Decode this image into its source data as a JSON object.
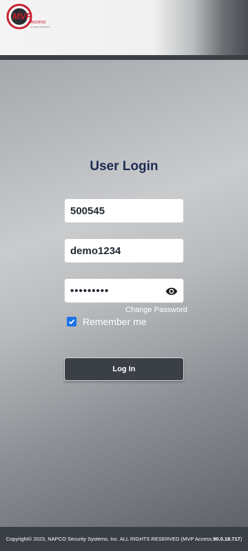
{
  "header": {
    "logo_text": "MVP",
    "logo_subtext": "Access",
    "logo_tagline": "by Napco Access Pro"
  },
  "login": {
    "title": "User Login",
    "username_value": "500545",
    "second_field_value": "demo1234",
    "password_masked": "•••••••••",
    "change_password": "Change Password",
    "remember_label": "Remember me",
    "remember_checked": true,
    "login_button": "Log In"
  },
  "footer": {
    "copyright_prefix": "Copyright© 2023, NAPCO Security Systems, Inc. ALL RIGHTS RESERVED (MVP Access, ",
    "version": "90.0.18.717",
    "copyright_suffix": ")"
  },
  "colors": {
    "title": "#1d2a52",
    "button_bg": "#3b4047",
    "footer_bg": "#3a3f45",
    "checkbox_accent": "#1a73e8",
    "logo_red": "#c8202f"
  },
  "icons": {
    "password_toggle": "eye-icon",
    "checkbox": "checkmark-icon"
  }
}
